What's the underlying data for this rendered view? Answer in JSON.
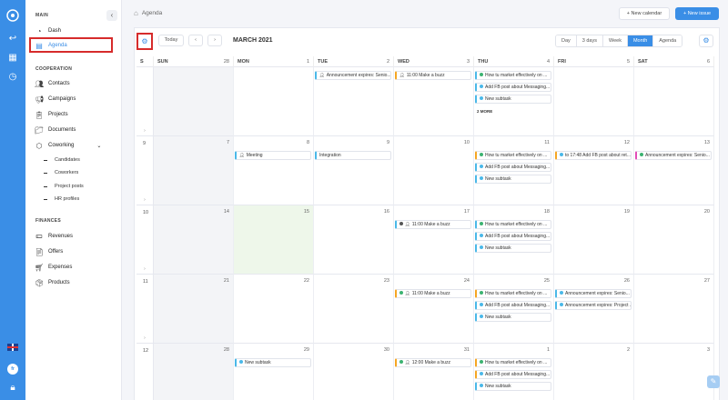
{
  "sidebar": {
    "section_main": "MAIN",
    "section_cooperation": "COOPERATION",
    "section_finances": "FINANCES",
    "main_items": [
      {
        "label": "Dash",
        "icon": "dashboard-icon"
      },
      {
        "label": "Agenda",
        "icon": "calendar-icon",
        "active": true
      }
    ],
    "coop_items": [
      {
        "label": "Contacts",
        "icon": "contacts-icon"
      },
      {
        "label": "Campaigns",
        "icon": "megaphone-icon"
      },
      {
        "label": "Projects",
        "icon": "clipboard-icon"
      },
      {
        "label": "Documents",
        "icon": "folder-icon"
      },
      {
        "label": "Coworking",
        "icon": "cube-icon"
      }
    ],
    "coworking_sub": [
      "Candidates",
      "Coworkers",
      "Project posts",
      "HR profiles"
    ],
    "finance_items": [
      {
        "label": "Revenues",
        "icon": "money-icon"
      },
      {
        "label": "Offers",
        "icon": "document-icon"
      },
      {
        "label": "Expenses",
        "icon": "cart-icon"
      },
      {
        "label": "Products",
        "icon": "box-icon"
      }
    ]
  },
  "rail": {
    "lang_badge": "fr"
  },
  "header": {
    "breadcrumb": "Agenda",
    "new_calendar_label": "New calendar",
    "new_issue_label": "New issue"
  },
  "toolbar": {
    "today_label": "Today",
    "prev_label": "‹",
    "next_label": "›",
    "month_title": "MARCH 2021",
    "views": [
      "Day",
      "3 days",
      "Week",
      "Month",
      "Agenda"
    ],
    "active_view": "Month"
  },
  "accent_color": "#3a8ee6",
  "calendar": {
    "week_col_label": "S",
    "headers": [
      {
        "name": "SUN",
        "date": "28"
      },
      {
        "name": "MON",
        "date": "1"
      },
      {
        "name": "TUE",
        "date": "2"
      },
      {
        "name": "WED",
        "date": "3"
      },
      {
        "name": "THU",
        "date": "4"
      },
      {
        "name": "FRI",
        "date": "5"
      },
      {
        "name": "SAT",
        "date": "6"
      }
    ],
    "weeks": [
      {
        "num": "",
        "days": [
          {
            "date": "",
            "events": []
          },
          {
            "date": "",
            "events": []
          },
          {
            "date": "",
            "events": [
              {
                "text": "Announcement expires: Senio...",
                "color": "blue",
                "icon": "person"
              }
            ]
          },
          {
            "date": "",
            "events": [
              {
                "text": "11:00 Make a buzz",
                "color": "orange",
                "icon": "person"
              }
            ]
          },
          {
            "date": "",
            "events": [
              {
                "text": "How tu market effectively on ...",
                "color": "blue",
                "dot": "#3cb371"
              },
              {
                "text": "Add FB post about Messaging...",
                "color": "blue",
                "dot": "#4ab8e8"
              },
              {
                "text": "New subtask",
                "color": "blue",
                "dot": "#4ab8e8"
              }
            ],
            "more": "2 MORE"
          },
          {
            "date": "",
            "events": []
          },
          {
            "date": "",
            "events": []
          }
        ]
      },
      {
        "num": "9",
        "days": [
          {
            "date": "7",
            "events": []
          },
          {
            "date": "8",
            "events": [
              {
                "text": "Meeting",
                "color": "blue",
                "icon": "person"
              }
            ]
          },
          {
            "date": "9",
            "events": [
              {
                "text": "Integration",
                "color": "blue"
              }
            ]
          },
          {
            "date": "10",
            "events": []
          },
          {
            "date": "11",
            "events": [
              {
                "text": "How tu market effectively on ...",
                "color": "orange",
                "dot": "#3cb371"
              },
              {
                "text": "Add FB post about Messaging...",
                "color": "blue",
                "dot": "#4ab8e8"
              },
              {
                "text": "New subtask",
                "color": "blue",
                "dot": "#4ab8e8"
              }
            ]
          },
          {
            "date": "12",
            "events": [
              {
                "text": "to 17:48 Add FB post about ret...",
                "color": "orange",
                "dot": "#4ab8e8"
              }
            ]
          },
          {
            "date": "13",
            "events": [
              {
                "text": "Announcement expires: Senio...",
                "color": "pink",
                "dot": "#3cb371"
              }
            ]
          }
        ]
      },
      {
        "num": "10",
        "days": [
          {
            "date": "14",
            "events": []
          },
          {
            "date": "15",
            "events": [],
            "today": true
          },
          {
            "date": "16",
            "events": []
          },
          {
            "date": "17",
            "events": [
              {
                "text": "11:00 Make a buzz",
                "color": "blue",
                "dot": "#555",
                "icon": "person"
              }
            ]
          },
          {
            "date": "18",
            "events": [
              {
                "text": "How tu market effectively on ...",
                "color": "blue",
                "dot": "#3cb371"
              },
              {
                "text": "Add FB post about Messaging...",
                "color": "blue",
                "dot": "#4ab8e8"
              },
              {
                "text": "New subtask",
                "color": "blue",
                "dot": "#4ab8e8"
              }
            ]
          },
          {
            "date": "19",
            "events": []
          },
          {
            "date": "20",
            "events": []
          }
        ]
      },
      {
        "num": "11",
        "days": [
          {
            "date": "21",
            "events": []
          },
          {
            "date": "22",
            "events": []
          },
          {
            "date": "23",
            "events": []
          },
          {
            "date": "24",
            "events": [
              {
                "text": "11:00 Make a buzz",
                "color": "orange",
                "dot": "#3cb371",
                "icon": "person"
              }
            ]
          },
          {
            "date": "25",
            "events": [
              {
                "text": "How tu market effectively on ...",
                "color": "orange",
                "dot": "#3cb371"
              },
              {
                "text": "Add FB post about Messaging...",
                "color": "blue",
                "dot": "#4ab8e8"
              },
              {
                "text": "New subtask",
                "color": "blue",
                "dot": "#4ab8e8"
              }
            ]
          },
          {
            "date": "26",
            "events": [
              {
                "text": "Announcement expires: Senio...",
                "color": "blue",
                "dot": "#4ab8e8"
              },
              {
                "text": "Announcement expires: Project ...",
                "color": "blue",
                "dot": "#4ab8e8"
              }
            ]
          },
          {
            "date": "27",
            "events": []
          }
        ]
      },
      {
        "num": "12",
        "days": [
          {
            "date": "28",
            "events": []
          },
          {
            "date": "29",
            "events": [
              {
                "text": "New subtask",
                "color": "blue",
                "dot": "#4ab8e8"
              }
            ]
          },
          {
            "date": "30",
            "events": []
          },
          {
            "date": "31",
            "events": [
              {
                "text": "12:00 Make a buzz",
                "color": "orange",
                "dot": "#3cb371",
                "icon": "person"
              }
            ]
          },
          {
            "date": "1",
            "events": [
              {
                "text": "How tu market effectively on ...",
                "color": "orange",
                "dot": "#3cb371"
              },
              {
                "text": "Add FB post about Messaging...",
                "color": "orange",
                "dot": "#4ab8e8"
              },
              {
                "text": "New subtask",
                "color": "blue",
                "dot": "#4ab8e8"
              }
            ]
          },
          {
            "date": "2",
            "events": []
          },
          {
            "date": "3",
            "events": []
          }
        ]
      }
    ]
  }
}
